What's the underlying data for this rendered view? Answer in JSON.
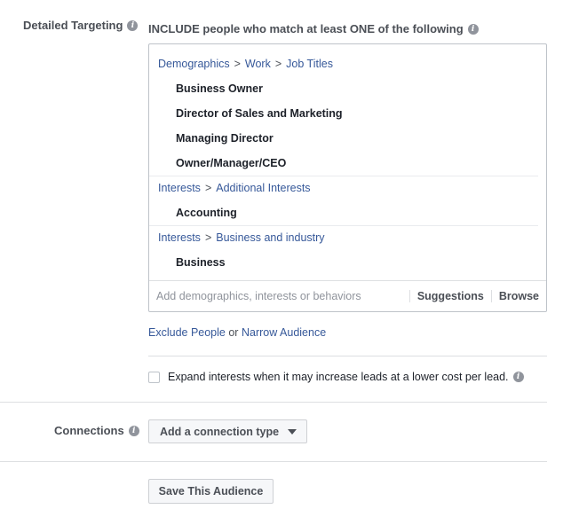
{
  "detailed_targeting": {
    "label": "Detailed Targeting",
    "heading": "INCLUDE people who match at least ONE of the following",
    "groups": [
      {
        "path": [
          "Demographics",
          "Work",
          "Job Titles"
        ],
        "items": [
          "Business Owner",
          "Director of Sales and Marketing",
          "Managing Director",
          "Owner/Manager/CEO"
        ]
      },
      {
        "path": [
          "Interests",
          "Additional Interests"
        ],
        "items": [
          "Accounting"
        ]
      },
      {
        "path": [
          "Interests",
          "Business and industry"
        ],
        "items": [
          "Business"
        ]
      }
    ],
    "separator": ">",
    "search_placeholder": "Add demographics, interests or behaviors",
    "suggestions_label": "Suggestions",
    "browse_label": "Browse"
  },
  "audience_links": {
    "exclude": "Exclude People",
    "or": "or",
    "narrow": "Narrow Audience"
  },
  "expand": {
    "label": "Expand interests when it may increase leads at a lower cost per lead.",
    "checked": false
  },
  "connections": {
    "label": "Connections",
    "dropdown_label": "Add a connection type"
  },
  "save_button": "Save This Audience",
  "icons": {
    "info": "info-icon",
    "caret": "caret-down-icon",
    "checkbox": "checkbox-icon"
  },
  "colors": {
    "link": "#365899",
    "label": "#4b4f56",
    "text": "#1d2129",
    "border": "#bec3c9"
  }
}
